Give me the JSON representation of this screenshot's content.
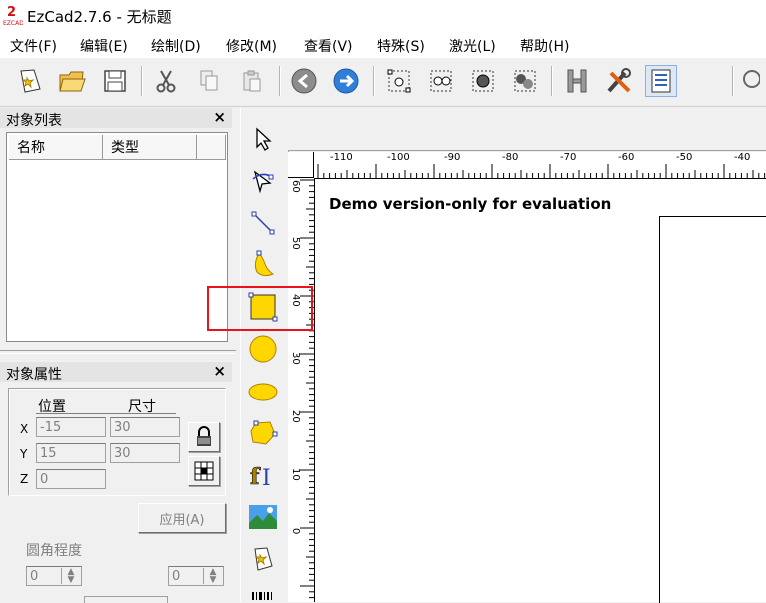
{
  "window": {
    "title": "EzCad2.7.6 - 无标题"
  },
  "menu": [
    {
      "label": "文件(F)"
    },
    {
      "label": "编辑(E)"
    },
    {
      "label": "绘制(D)"
    },
    {
      "label": "修改(M)"
    },
    {
      "label": "查看(V)"
    },
    {
      "label": "特殊(S)"
    },
    {
      "label": "激光(L)"
    },
    {
      "label": "帮助(H)"
    }
  ],
  "toolbar": [
    "new-icon",
    "open-icon",
    "save-icon",
    "cut-icon",
    "copy-icon",
    "paste-icon",
    "undo-icon",
    "redo-icon",
    "node-edit-icon",
    "node-select-icon",
    "node-join-icon",
    "node-break-icon",
    "hatch-icon",
    "tools-icon",
    "properties-icon"
  ],
  "object_list": {
    "title": "对象列表",
    "close": "×",
    "columns": [
      "名称",
      "类型"
    ]
  },
  "object_props": {
    "title": "对象属性",
    "close": "×",
    "position_label": "位置",
    "size_label": "尺寸",
    "x_label": "X",
    "y_label": "Y",
    "z_label": "Z",
    "x_pos": "-15",
    "y_pos": "15",
    "z_pos": "0",
    "x_size": "30",
    "y_size": "30",
    "apply_label": "应用(A)",
    "corner_label": "圆角程度",
    "corner_left": "0",
    "corner_right": "0"
  },
  "ruler": {
    "top_labels": [
      "-110",
      "-100",
      "-90",
      "-80",
      "-70",
      "-60",
      "-50",
      "-40"
    ],
    "left_labels": [
      "60",
      "50",
      "40",
      "30",
      "20",
      "10",
      "0"
    ]
  },
  "canvas": {
    "watermark": "Demo version-only for evaluation"
  },
  "colors": {
    "highlight": "#e8141a",
    "shape_fill": "#ffd700"
  }
}
